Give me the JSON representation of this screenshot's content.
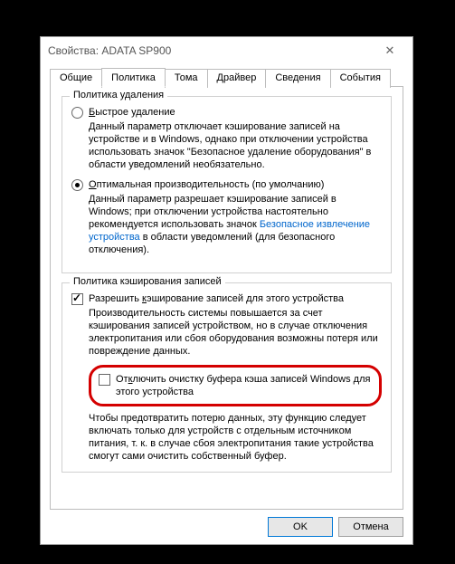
{
  "window": {
    "title": "Свойства: ADATA SP900"
  },
  "tabs": {
    "t0": "Общие",
    "t1": "Политика",
    "t2": "Тома",
    "t3": "Драйвер",
    "t4": "Сведения",
    "t5": "События"
  },
  "group1": {
    "title": "Политика удаления",
    "opt1": {
      "label": "Быстрое удаление",
      "desc": "Данный параметр отключает кэширование записей на устройстве и в Windows, однако при отключении устройства использовать значок \"Безопасное удаление оборудования\" в области уведомлений необязательно."
    },
    "opt2": {
      "label": "Оптимальная производительность (по умолчанию)",
      "desc_a": "Данный параметр разрешает кэширование записей в Windows; при отключении устройства настоятельно рекомендуется использовать значок ",
      "link": "Безопасное извлечение устройства",
      "desc_b": " в области уведомлений (для безопасного отключения)."
    }
  },
  "group2": {
    "title": "Политика кэширования записей",
    "chk1": {
      "label": "Разрешить кэширование записей для этого устройства",
      "desc": "Производительность системы повышается за счет кэширования записей устройством, но в случае отключения электропитания или сбоя оборудования возможны потеря или повреждение данных."
    },
    "chk2": {
      "label": "Отключить очистку буфера кэша записей Windows для этого устройства",
      "desc": "Чтобы предотвратить потерю данных, эту функцию следует включать только для устройств с отдельным источником питания, т. к. в случае сбоя электропитания такие устройства смогут сами очистить собственный буфер."
    }
  },
  "buttons": {
    "ok": "OK",
    "cancel": "Отмена"
  }
}
